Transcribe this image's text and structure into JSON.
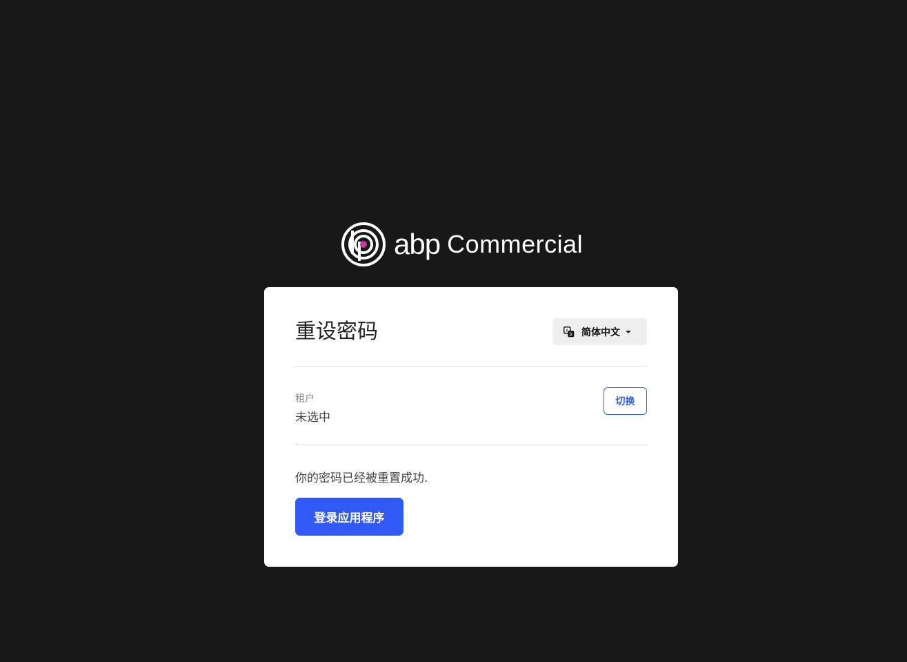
{
  "brand": {
    "name_primary": "abp",
    "name_secondary": "Commercial",
    "mark_icon": "abp-logo-icon",
    "accent_color": "#c33b9a"
  },
  "card": {
    "title": "重设密码",
    "language": {
      "label": "简体中文",
      "icon": "translate-icon"
    },
    "tenant": {
      "label": "租户",
      "value": "未选中",
      "switch_label": "切换"
    },
    "message": "你的密码已经被重置成功.",
    "login_button_label": "登录应用程序"
  },
  "colors": {
    "background": "#181818",
    "primary": "#3159f5"
  }
}
